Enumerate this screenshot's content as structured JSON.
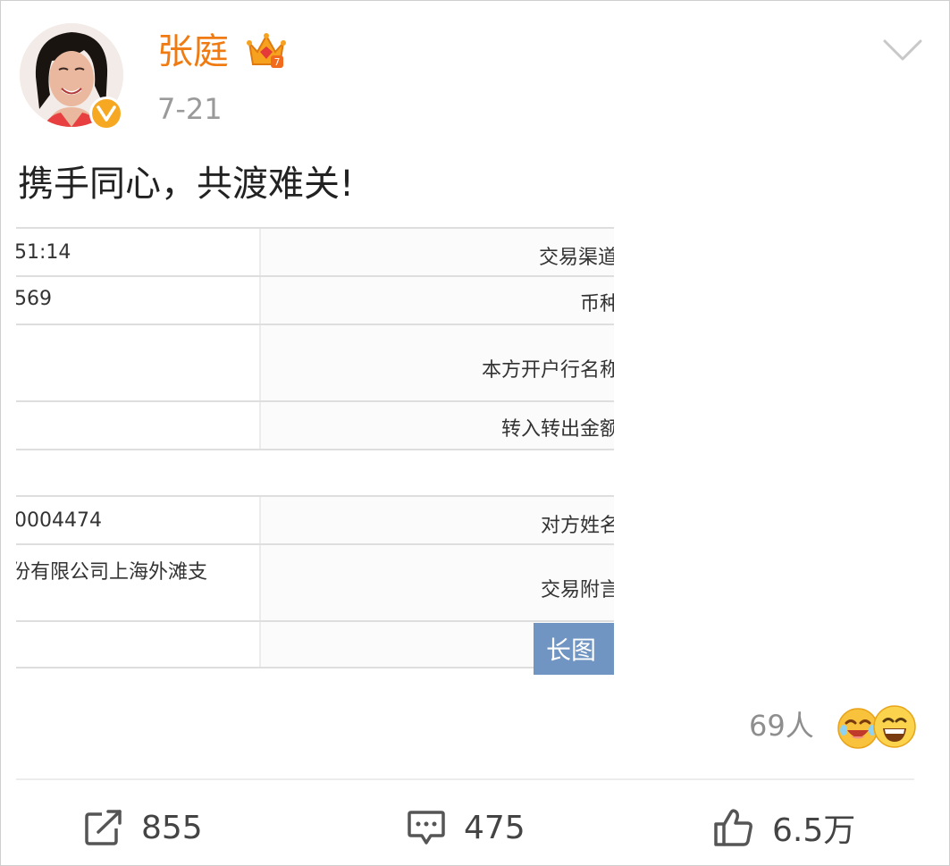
{
  "post": {
    "username": "张庭",
    "date": "7-21",
    "text": "携手同心，共渡难关!",
    "icons": {
      "verified": "verified-v-badge-icon",
      "member": "vip-crown-icon",
      "menu": "chevron-down-icon"
    }
  },
  "receipt": {
    "rows": [
      {
        "left": "51:14",
        "right": "交易渠道"
      },
      {
        "left": "569",
        "right": "币种"
      },
      {
        "left": "",
        "right": "本方开户行名称"
      },
      {
        "left": "",
        "right": "转入转出金额"
      },
      {
        "left": "0004474",
        "right": "对方姓名"
      },
      {
        "left": "份有限公司上海外滩支",
        "right": "交易附言"
      },
      {
        "left": "",
        "right": ""
      }
    ],
    "long_image_label": "长图"
  },
  "reactions": {
    "count_text": "69人",
    "emojis": [
      "laugh-tears-emoji-icon",
      "grin-emoji-icon"
    ]
  },
  "actions": {
    "repost": {
      "icon": "repost-icon",
      "count": "855"
    },
    "comment": {
      "icon": "comment-icon",
      "count": "475"
    },
    "like": {
      "icon": "thumbs-up-icon",
      "count": "6.5万"
    }
  },
  "colors": {
    "username": "#f07b12",
    "verified_badge": "#f6a823",
    "long_image_badge": "#7095c2",
    "muted_text": "#9a9a9a"
  }
}
